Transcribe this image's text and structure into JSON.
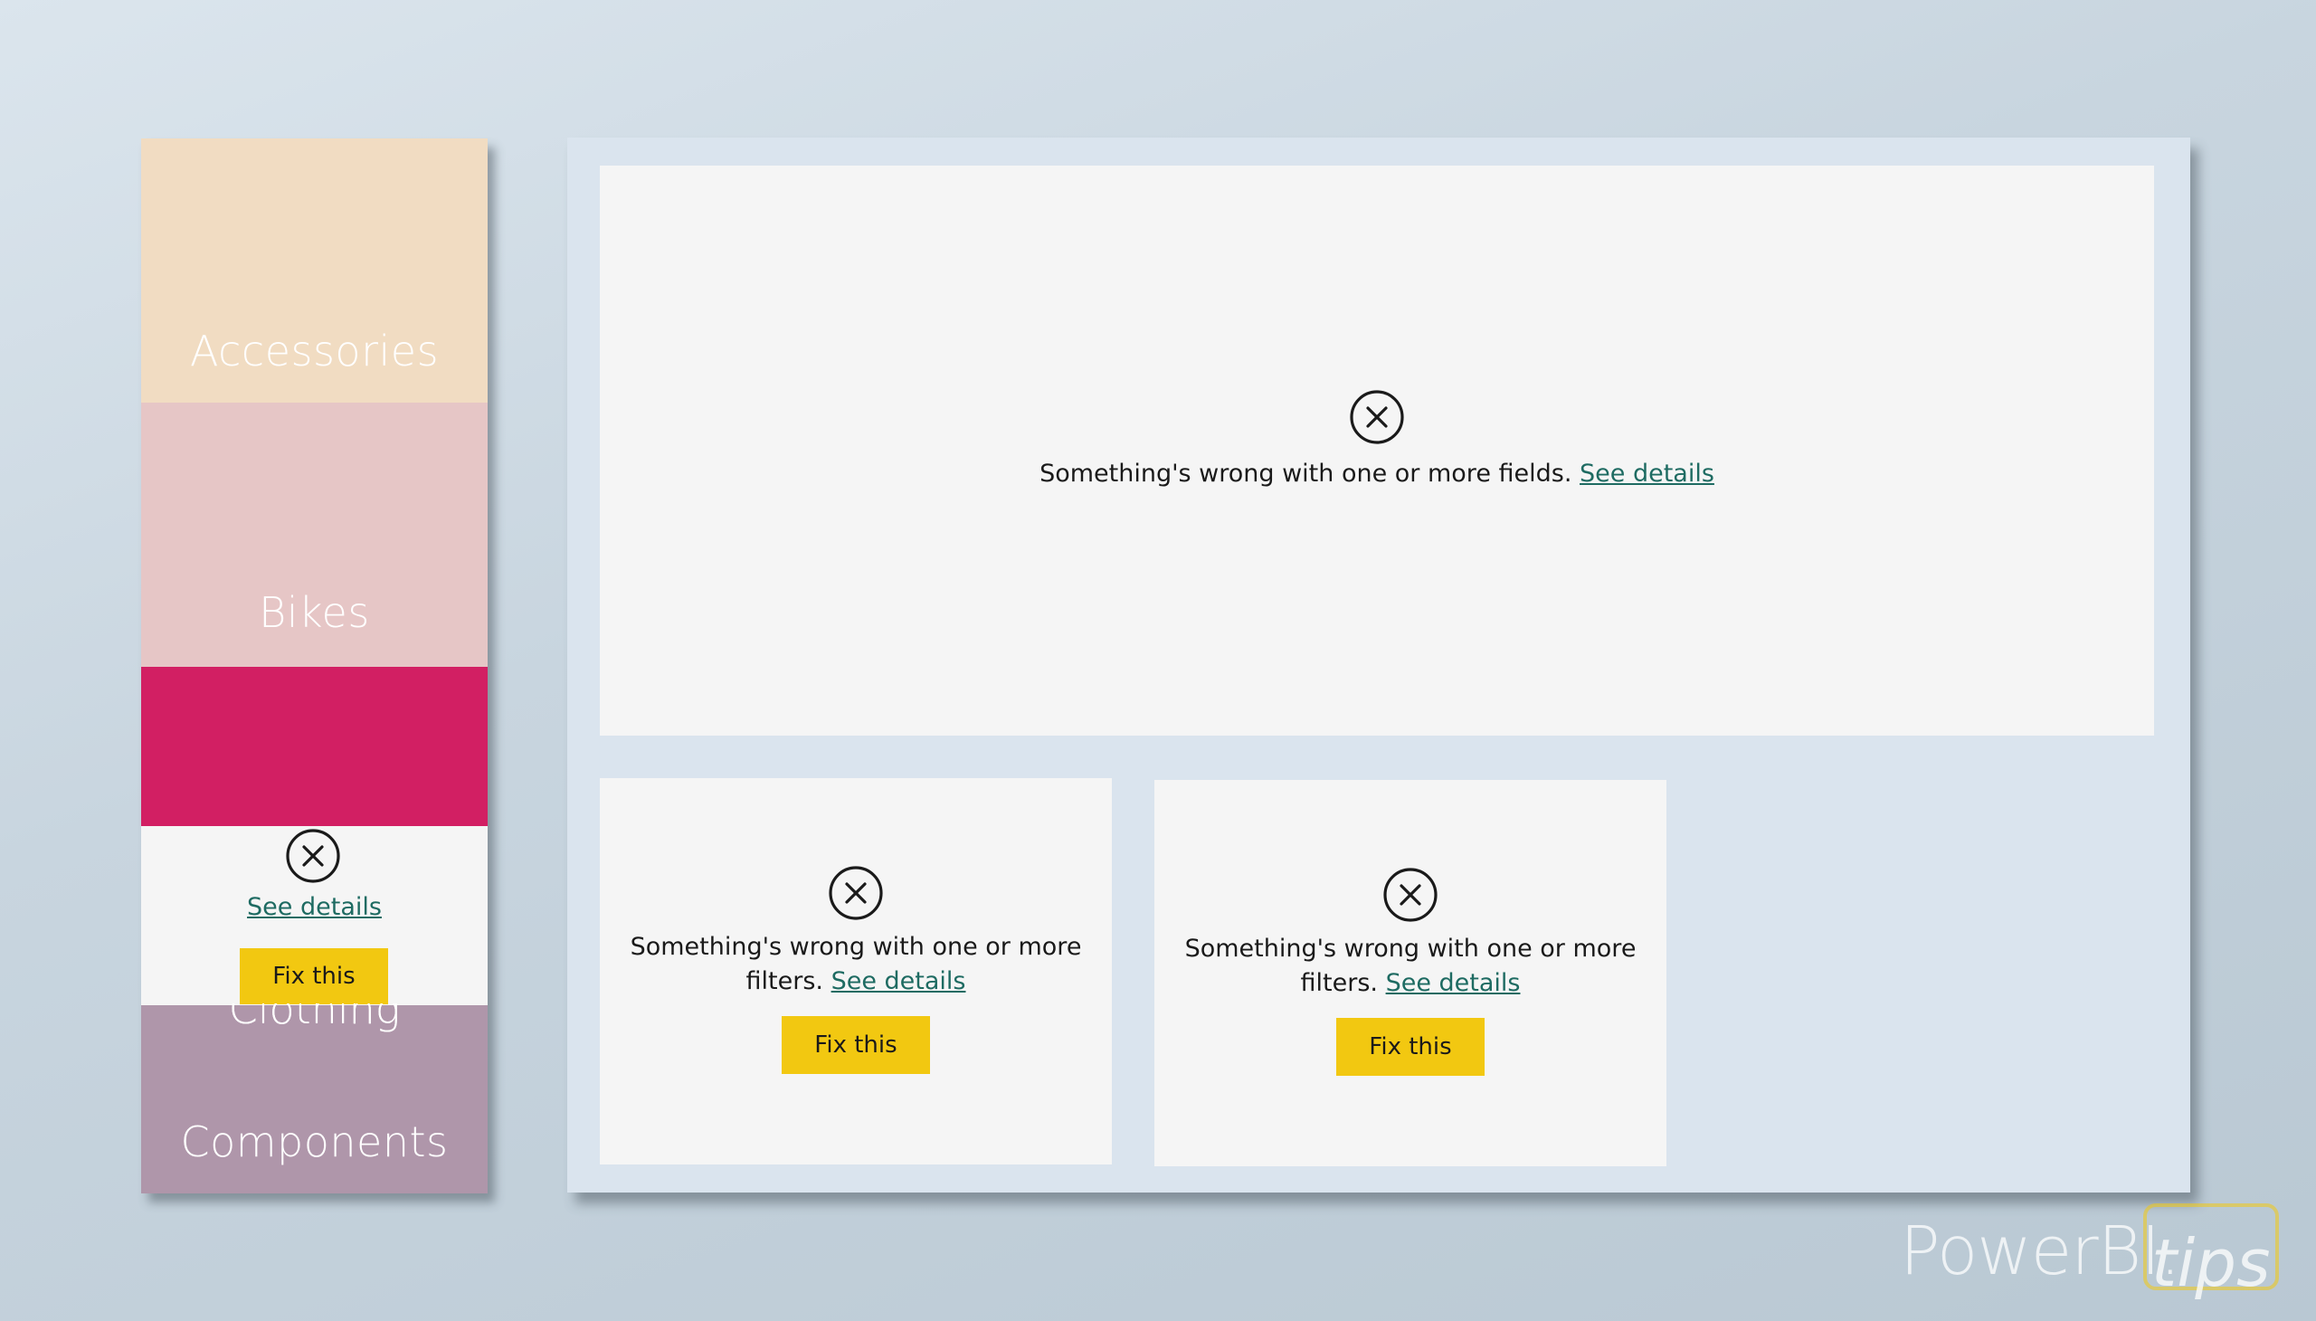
{
  "slicer": {
    "items": [
      {
        "label": "Accessories",
        "color": "#f1dcc2"
      },
      {
        "label": "Bikes",
        "color": "#e6c6c6"
      },
      {
        "label": "Clothing",
        "color": "#d21f63"
      },
      {
        "label": "Components",
        "color": "#af96aa"
      }
    ],
    "error": {
      "icon": "error-circle-x-icon",
      "see_details": "See details",
      "fix_button": "Fix this"
    }
  },
  "visuals": {
    "main": {
      "icon": "error-circle-x-icon",
      "message": "Something's wrong with one or more fields.",
      "see_details": "See details"
    },
    "left": {
      "icon": "error-circle-x-icon",
      "message_line1": "Something's wrong with one or more",
      "message_line2": "filters.",
      "see_details": "See details",
      "fix_button": "Fix this"
    },
    "right": {
      "icon": "error-circle-x-icon",
      "message_line1": "Something's wrong with one or more",
      "message_line2": "filters.",
      "see_details": "See details",
      "fix_button": "Fix this"
    }
  },
  "watermark": {
    "brand": "PowerBI.",
    "suffix": "tips"
  },
  "colors": {
    "canvas": "#dae4ee",
    "visual_bg": "#f5f5f5",
    "link": "#1e6b62",
    "fix_button": "#f2c811"
  }
}
